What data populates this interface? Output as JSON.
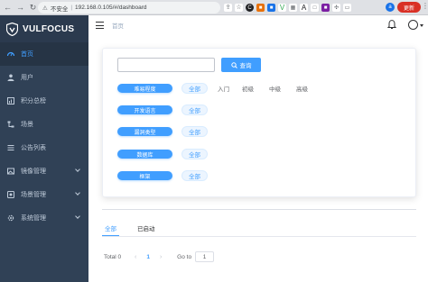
{
  "browser": {
    "security_label": "不安全",
    "url": "192.168.0.105/#/dashboard",
    "profile_initial": "a",
    "update_label": "更新"
  },
  "sidebar": {
    "brand": "VULFOCUS",
    "items": [
      {
        "label": "首页",
        "icon": "dashboard-icon"
      },
      {
        "label": "用户",
        "icon": "user-icon"
      },
      {
        "label": "积分总榜",
        "icon": "chart-icon"
      },
      {
        "label": "场景",
        "icon": "tree-icon"
      },
      {
        "label": "公告列表",
        "icon": "list-icon"
      },
      {
        "label": "镜像管理",
        "icon": "image-icon"
      },
      {
        "label": "场景管理",
        "icon": "scene-icon"
      },
      {
        "label": "系统管理",
        "icon": "settings-icon"
      }
    ]
  },
  "topbar": {
    "breadcrumb": "首页"
  },
  "filters": {
    "search_placeholder": "",
    "search_button": "查询",
    "rows": [
      {
        "tag": "难易程度",
        "options": [
          "全部",
          "入门",
          "初级",
          "中级",
          "高级"
        ]
      },
      {
        "tag": "开发语言",
        "options": [
          "全部"
        ]
      },
      {
        "tag": "漏洞类型",
        "options": [
          "全部"
        ]
      },
      {
        "tag": "数据库",
        "options": [
          "全部"
        ]
      },
      {
        "tag": "框架",
        "options": [
          "全部"
        ]
      }
    ]
  },
  "tabs": {
    "all": "全部",
    "started": "已启动"
  },
  "pagination": {
    "total": "Total 0",
    "current_page": "1",
    "goto_label": "Go to",
    "goto_value": "1"
  },
  "colors": {
    "accent": "#409eff",
    "sidebar_bg": "#304156",
    "update_red": "#d93025"
  }
}
